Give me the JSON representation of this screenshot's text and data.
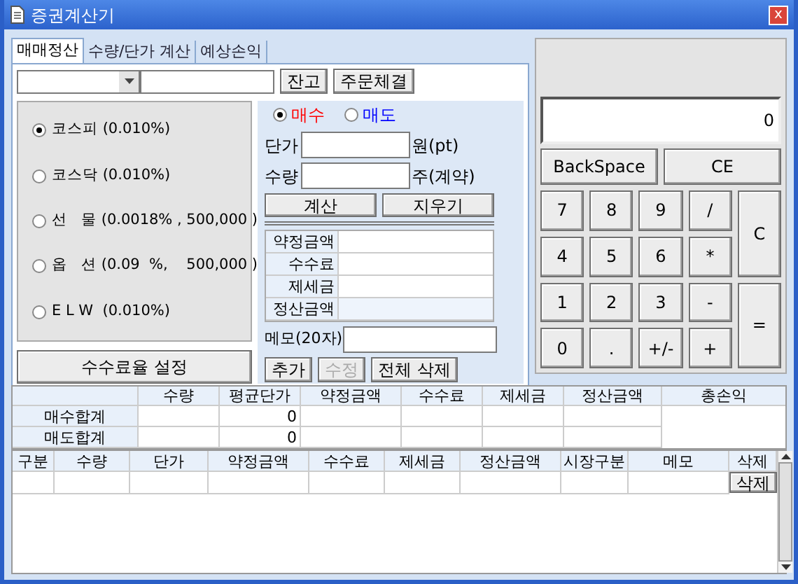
{
  "window": {
    "title": "증권계산기",
    "close": "x"
  },
  "tabs": [
    {
      "label": "매매정산",
      "selected": true
    },
    {
      "label": "수량/단가 계산",
      "selected": false
    },
    {
      "label": "예상손익",
      "selected": false
    }
  ],
  "top_buttons": [
    "잔고",
    "주문체결"
  ],
  "markets": [
    {
      "label": "코스피 (0.010%)",
      "selected": true
    },
    {
      "label": "코스닥 (0.010%)",
      "selected": false
    },
    {
      "label": "선   물 (0.0018% , 500,000 )",
      "selected": false
    },
    {
      "label": "옵   션 (0.09  %,    500,000 )",
      "selected": false
    },
    {
      "label": "E L W  (0.010%)",
      "selected": false
    }
  ],
  "fee_button": "수수료율 설정",
  "sides": [
    {
      "label": "매수",
      "selected": true,
      "color": "#ff0000"
    },
    {
      "label": "매도",
      "selected": false,
      "color": "#0000ff"
    }
  ],
  "inputs": [
    {
      "label": "단가",
      "unit": "원(pt)"
    },
    {
      "label": "수량",
      "unit": "주(계약)"
    }
  ],
  "calc_buttons": [
    "계산",
    "지우기"
  ],
  "results": [
    "약정금액",
    "수수료",
    "제세금",
    "정산금액"
  ],
  "memo_label": "메모(20자)",
  "actions": [
    {
      "label": "추가",
      "disabled": false
    },
    {
      "label": "수정",
      "disabled": true
    },
    {
      "label": "전체 삭제",
      "disabled": false
    }
  ],
  "calculator": {
    "display": "0",
    "top_keys": [
      "BackSpace",
      "CE"
    ],
    "keys": [
      {
        "label": "7",
        "kind": "normal"
      },
      {
        "label": "8",
        "kind": "normal"
      },
      {
        "label": "9",
        "kind": "normal"
      },
      {
        "label": "/",
        "kind": "normal"
      },
      {
        "label": "C",
        "kind": "tall"
      },
      {
        "label": "4",
        "kind": "normal"
      },
      {
        "label": "5",
        "kind": "normal"
      },
      {
        "label": "6",
        "kind": "normal"
      },
      {
        "label": "*",
        "kind": "normal"
      },
      {
        "label": "1",
        "kind": "normal"
      },
      {
        "label": "2",
        "kind": "normal"
      },
      {
        "label": "3",
        "kind": "normal"
      },
      {
        "label": "-",
        "kind": "normal"
      },
      {
        "label": "=",
        "kind": "tall"
      },
      {
        "label": "0",
        "kind": "normal"
      },
      {
        "label": ".",
        "kind": "normal"
      },
      {
        "label": "+/-",
        "kind": "normal"
      },
      {
        "label": "+",
        "kind": "normal"
      }
    ]
  },
  "summary": {
    "columns": [
      "수량",
      "평균단가",
      "약정금액",
      "수수료",
      "제세금",
      "정산금액",
      "총손익"
    ],
    "rows": [
      {
        "label": "매수합계",
        "avg_price": "0"
      },
      {
        "label": "매도합계",
        "avg_price": "0"
      }
    ]
  },
  "details": {
    "columns": [
      "구분",
      "수량",
      "단가",
      "약정금액",
      "수수료",
      "제세금",
      "정산금액",
      "시장구분",
      "메모",
      "삭제"
    ],
    "row_button": "삭제"
  }
}
